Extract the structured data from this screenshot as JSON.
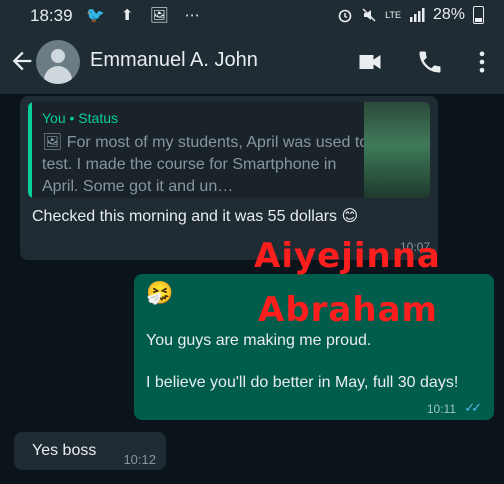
{
  "status_bar": {
    "time": "18:39",
    "left_icons": "🐦 ⬆ 🖼 ⋯",
    "network": "LTE",
    "battery": "28%"
  },
  "header": {
    "contact_name": "Emmanuel A. John"
  },
  "messages": {
    "incoming_1": {
      "quote_author": "You • Status",
      "quote_text": "🖼 For most of my students, April was used to test. I made the course for Smartphone in April. Some got it and un…",
      "text": "Checked this morning and it was 55 dollars 😊",
      "time": "10:07"
    },
    "outgoing_1": {
      "emoji": "🤧",
      "line1": "You guys are making me proud.",
      "line2": "I believe you'll do better in May, full 30 days!",
      "time": "10:11",
      "ticks": "✓✓"
    },
    "incoming_2": {
      "text": "Yes boss",
      "time": "10:12"
    }
  },
  "overlay": {
    "line1": "Aiyejinna",
    "line2": "Abraham"
  },
  "colors": {
    "header_bg": "#1f2c34",
    "chat_bg": "#0b141a",
    "incoming_bubble": "#202c33",
    "outgoing_bubble": "#005c4b",
    "accent_green": "#06cf9c",
    "overlay_red": "#ff1e1e"
  }
}
